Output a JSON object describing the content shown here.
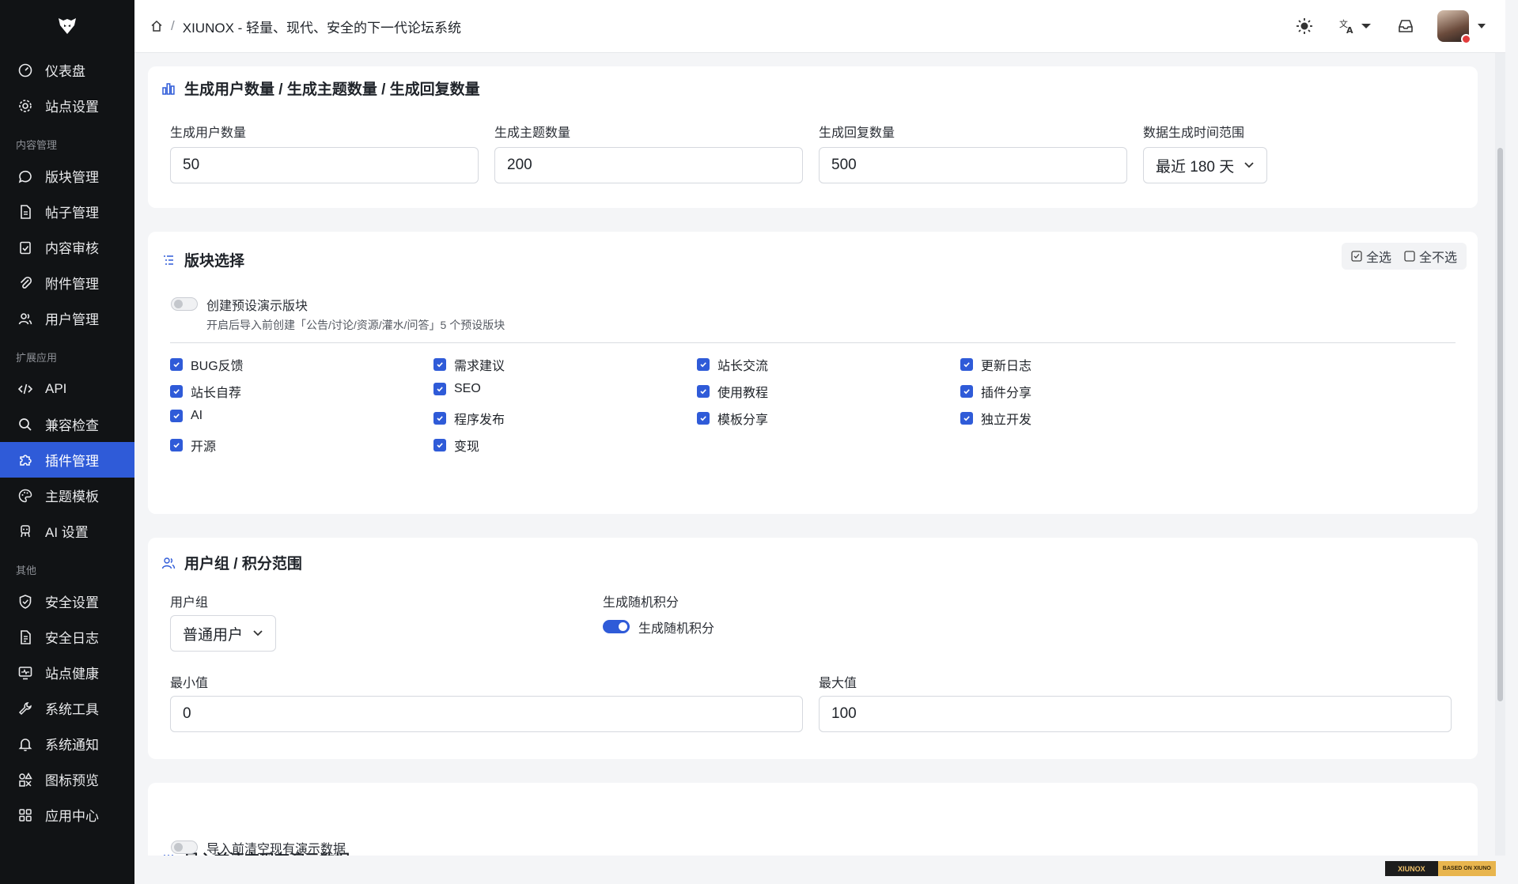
{
  "sidebar": {
    "items_top": [
      {
        "label": "仪表盘",
        "icon": "dashboard-icon"
      },
      {
        "label": "站点设置",
        "icon": "gear-icon"
      }
    ],
    "section_content": "内容管理",
    "items_content": [
      {
        "label": "版块管理",
        "icon": "chat-bubble-icon"
      },
      {
        "label": "帖子管理",
        "icon": "document-icon"
      },
      {
        "label": "内容审核",
        "icon": "clipboard-check-icon"
      },
      {
        "label": "附件管理",
        "icon": "paperclip-icon"
      },
      {
        "label": "用户管理",
        "icon": "users-icon"
      }
    ],
    "section_ext": "扩展应用",
    "items_ext": [
      {
        "label": "API",
        "icon": "code-icon"
      },
      {
        "label": "兼容检查",
        "icon": "search-icon"
      },
      {
        "label": "插件管理",
        "icon": "puzzle-icon",
        "active": true
      },
      {
        "label": "主题模板",
        "icon": "palette-icon"
      },
      {
        "label": "AI 设置",
        "icon": "ai-chip-icon"
      }
    ],
    "section_other": "其他",
    "items_other": [
      {
        "label": "安全设置",
        "icon": "shield-icon"
      },
      {
        "label": "安全日志",
        "icon": "log-icon"
      },
      {
        "label": "站点健康",
        "icon": "monitor-heart-icon"
      },
      {
        "label": "系统工具",
        "icon": "wrench-icon"
      },
      {
        "label": "系统通知",
        "icon": "bell-icon"
      },
      {
        "label": "图标预览",
        "icon": "shapes-icon"
      },
      {
        "label": "应用中心",
        "icon": "apps-icon"
      }
    ]
  },
  "header": {
    "breadcrumb_title": "XIUNOX - 轻量、现代、安全的下一代论坛系统"
  },
  "gen_card": {
    "title": "生成用户数量 / 生成主题数量 / 生成回复数量",
    "users_label": "生成用户数量",
    "users_value": "50",
    "topics_label": "生成主题数量",
    "topics_value": "200",
    "replies_label": "生成回复数量",
    "replies_value": "500",
    "range_label": "数据生成时间范围",
    "range_value": "最近 180 天"
  },
  "forum_card": {
    "title": "版块选择",
    "select_all": "全选",
    "select_none": "全不选",
    "preset_toggle_label": "创建预设演示版块",
    "preset_toggle_on": false,
    "preset_hint": "开启后导入前创建「公告/讨论/资源/灌水/问答」5 个预设版块",
    "forums": [
      [
        "BUG反馈",
        "需求建议",
        "站长交流",
        "更新日志"
      ],
      [
        "站长自荐",
        "SEO",
        "使用教程",
        "插件分享"
      ],
      [
        "AI",
        "程序发布",
        "模板分享",
        "独立开发"
      ],
      [
        "开源",
        "变现"
      ]
    ]
  },
  "group_card": {
    "title": "用户组 / 积分范围",
    "group_label": "用户组",
    "group_value": "普通用户",
    "random_label": "生成随机积分",
    "random_toggle_label": "生成随机积分",
    "random_toggle_on": true,
    "min_label": "最小值",
    "min_value": "0",
    "max_label": "最大值",
    "max_value": "100"
  },
  "clear_card": {
    "title": "导入前清空现有演示数据",
    "toggle_label": "导入前清空现有演示数据",
    "toggle_on": false
  },
  "footer_badge": {
    "left": "XIUNOX",
    "right": "BASED ON XIUNO"
  },
  "colors": {
    "accent": "#2f5bd8",
    "sidebar_bg": "#111315"
  }
}
